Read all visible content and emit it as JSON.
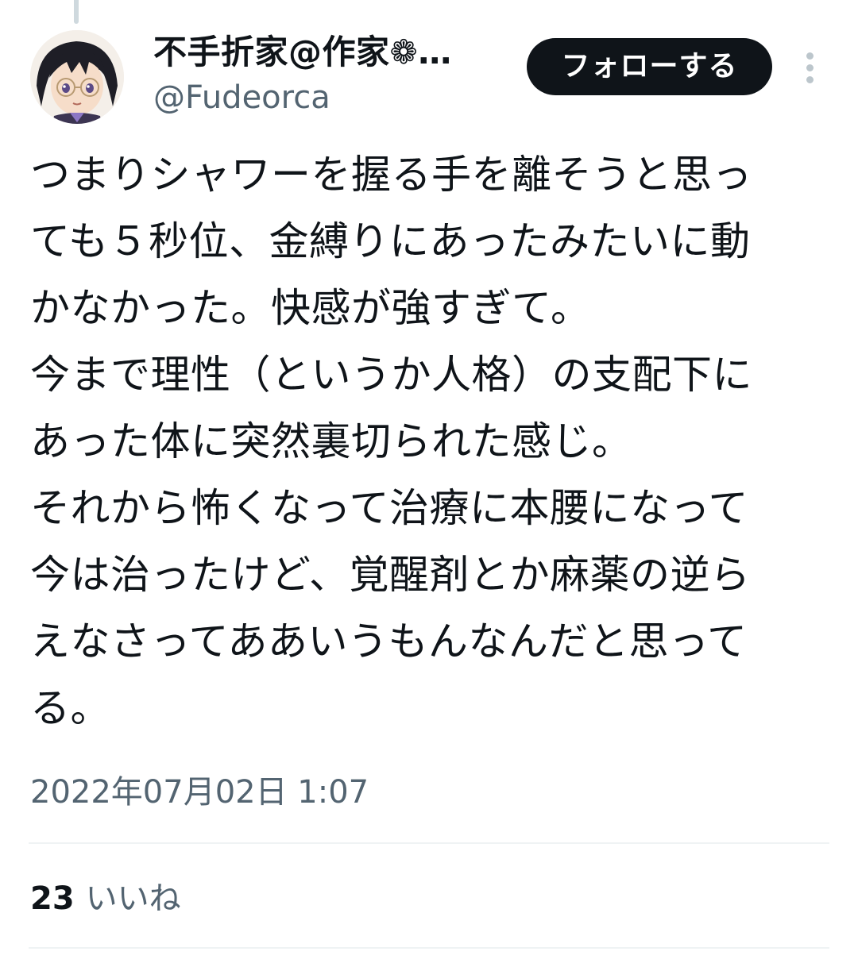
{
  "author": {
    "display_name": "不手折家@作家❁…",
    "handle": "@Fudeorca",
    "avatar_icon": "avatar-anime-girl-glasses"
  },
  "header": {
    "follow_label": "フォローする",
    "more_icon": "vertical-dots-icon"
  },
  "tweet": {
    "lines": [
      "つまりシャワーを握る手を離そうと思っ",
      "ても５秒位、金縛りにあったみたいに動",
      "かなかった。快感が強すぎて。",
      "今まで理性（というか人格）の支配下に",
      "あった体に突然裏切られた感じ。",
      "それから怖くなって治療に本腰になって",
      "今は治ったけど、覚醒剤とか麻薬の逆ら",
      "えなさってああいうもんなんだと思って",
      "る。"
    ],
    "timestamp": "2022年07月02日 1:07"
  },
  "stats": {
    "likes_count": "23",
    "likes_label": "いいね"
  },
  "colors": {
    "text": "#0f1419",
    "secondary": "#536471",
    "divider": "#eff3f4",
    "button_bg": "#0f1419",
    "button_text": "#ffffff"
  }
}
